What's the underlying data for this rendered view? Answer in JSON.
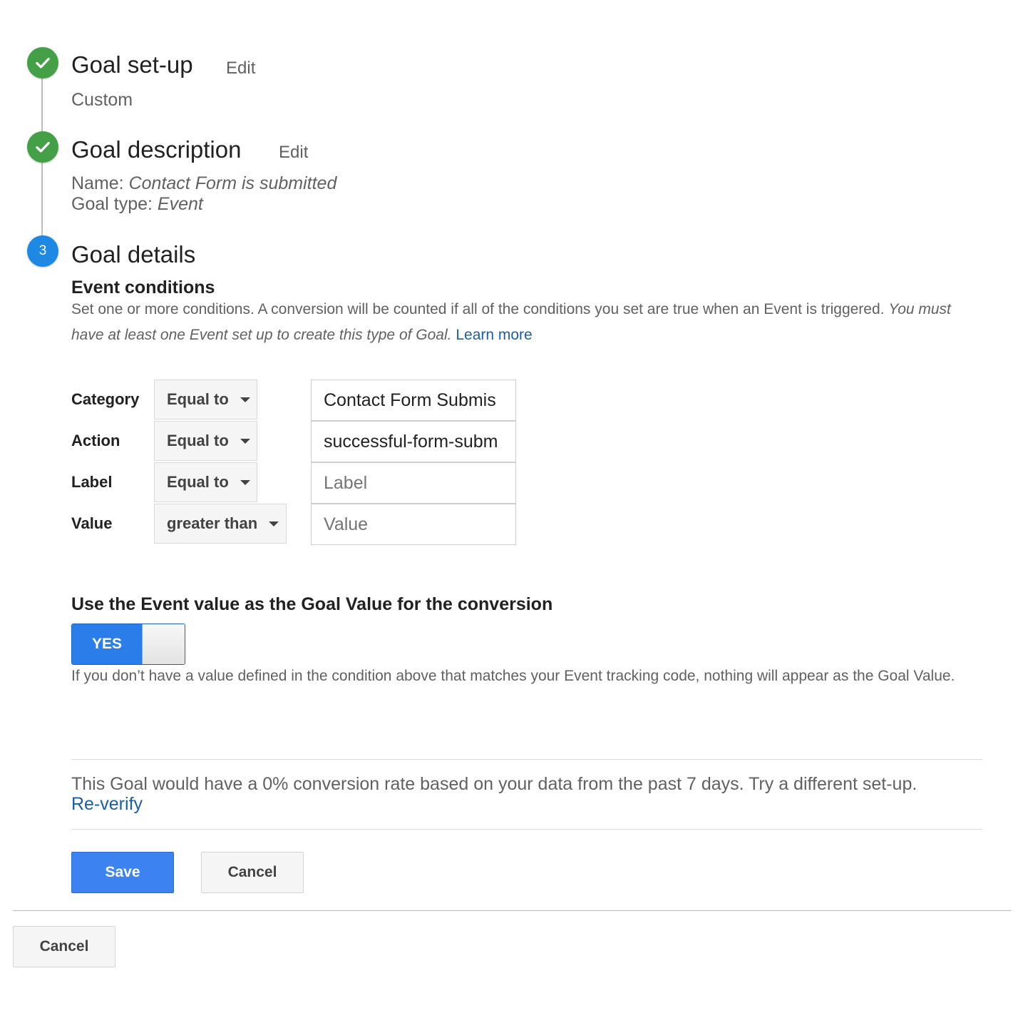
{
  "steps": {
    "setup": {
      "title": "Goal set-up",
      "edit_label": "Edit",
      "value": "Custom"
    },
    "description": {
      "title": "Goal description",
      "edit_label": "Edit",
      "name_label": "Name:",
      "name_value": "Contact Form is submitted",
      "type_label": "Goal type:",
      "type_value": "Event"
    },
    "details": {
      "number": "3",
      "title": "Goal details"
    }
  },
  "event_conditions": {
    "heading": "Event conditions",
    "description": "Set one or more conditions. A conversion will be counted if all of the conditions you set are true when an Event is triggered.",
    "note": "You must have at least one Event set up to create this type of Goal.",
    "learn_more": "Learn more",
    "rows": [
      {
        "label": "Category",
        "operator": "Equal to",
        "value": "Contact Form Submis",
        "placeholder": ""
      },
      {
        "label": "Action",
        "operator": "Equal to",
        "value": "successful-form-subm",
        "placeholder": ""
      },
      {
        "label": "Label",
        "operator": "Equal to",
        "value": "",
        "placeholder": "Label"
      },
      {
        "label": "Value",
        "operator": "greater than",
        "value": "",
        "placeholder": "Value"
      }
    ]
  },
  "goal_value": {
    "heading": "Use the Event value as the Goal Value for the conversion",
    "toggle_label": "YES",
    "toggle_on": true,
    "help_text": "If you don’t have a value defined in the condition above that matches your Event tracking code, nothing will appear as the Goal Value."
  },
  "verify": {
    "text": "This Goal would have a 0% conversion rate based on your data from the past 7 days. Try a different set-up.",
    "link": "Re-verify"
  },
  "actions": {
    "save_label": "Save",
    "cancel_label": "Cancel"
  },
  "footer": {
    "cancel_label": "Cancel"
  },
  "colors": {
    "done_step": "#43a047",
    "current_step": "#1e88e5",
    "primary_button": "#3c82f0",
    "link": "#1a5ea8"
  }
}
